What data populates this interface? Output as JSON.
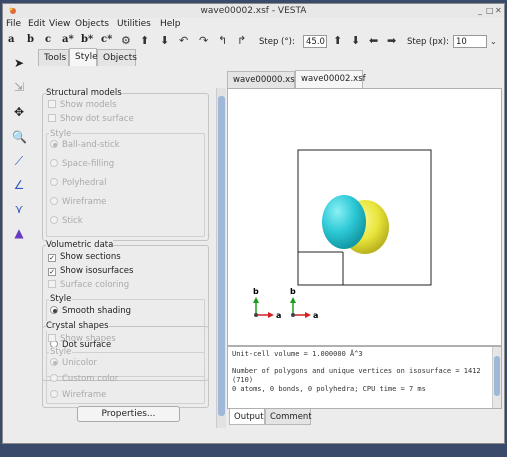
{
  "window": {
    "title": "wave00002.xsf - VESTA",
    "minimize": "_",
    "maximize": "□",
    "close": "✕"
  },
  "menu": [
    "File",
    "Edit",
    "View",
    "Objects",
    "Utilities",
    "Help"
  ],
  "toolbar": {
    "axes": [
      "a",
      "b",
      "c",
      "a*",
      "b*",
      "c*"
    ],
    "step_deg_label": "Step (°):",
    "step_deg_value": "45.0",
    "step_px_label": "Step (px):",
    "step_px_value": "10"
  },
  "panel_tabs": [
    "Tools",
    "Style",
    "Objects"
  ],
  "active_panel_tab": "Style",
  "structural_models": {
    "label": "Structural models",
    "show_models": "Show models",
    "show_dot_surface": "Show dot surface",
    "style_label": "Style",
    "styles": [
      "Ball-and-stick",
      "Space-filling",
      "Polyhedral",
      "Wireframe",
      "Stick"
    ]
  },
  "volumetric": {
    "label": "Volumetric data",
    "show_sections": "Show sections",
    "show_isosurfaces": "Show isosurfaces",
    "surface_coloring": "Surface coloring",
    "style_label": "Style",
    "styles": [
      "Smooth shading",
      "Wireframe",
      "Dot surface"
    ]
  },
  "crystal_shapes": {
    "label": "Crystal shapes",
    "show_shapes": "Show shapes",
    "style_label": "Style",
    "styles": [
      "Unicolor",
      "Custom color",
      "Wireframe"
    ]
  },
  "properties_button": "Properties...",
  "file_tabs": [
    "wave00000.xsf",
    "wave00002.xsf"
  ],
  "axes_labels": {
    "a": "a",
    "b": "b"
  },
  "console": {
    "line1": "Unit-cell volume = 1.000000 Å^3",
    "line2": "Number of polygons and unique vertices on isosurface = 1412",
    "line3": "(710)",
    "line4": "0 atoms, 0 bonds, 0 polyhedra; CPU time = 7 ms"
  },
  "bottom_tabs": [
    "Output",
    "Comment"
  ],
  "colors": {
    "cyan_lobe": "#2ec9d6",
    "yellow_lobe": "#e8e43a",
    "axis_a": "#d42020",
    "axis_b": "#1a9e1a"
  }
}
